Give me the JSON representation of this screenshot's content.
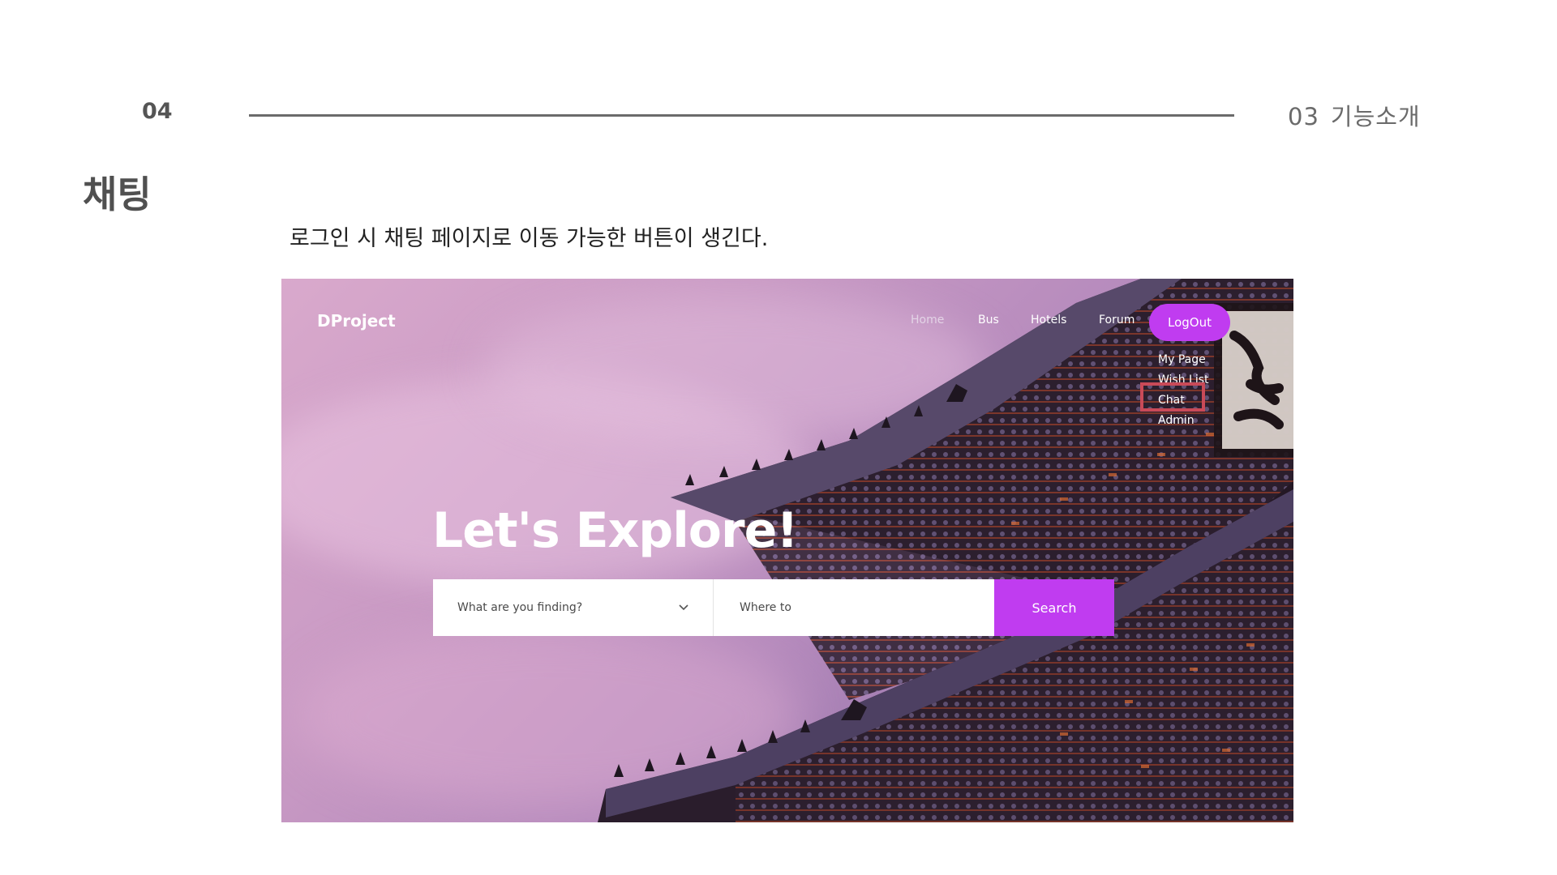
{
  "slide": {
    "page_number": "04",
    "section_number": "03",
    "section_title": "기능소개",
    "title": "채팅",
    "description": "로그인 시 채팅 페이지로 이동 가능한 버튼이 생긴다."
  },
  "site": {
    "brand": "DProject",
    "nav": {
      "home": "Home",
      "bus": "Bus",
      "hotels": "Hotels",
      "forum": "Forum",
      "logout": "LogOut"
    },
    "dropdown": [
      "My Page",
      "Wish List",
      "Chat",
      "Admin"
    ],
    "hero_title": "Let's Explore!",
    "search": {
      "select_placeholder": "What are you finding?",
      "where_placeholder": "Where to",
      "button": "Search"
    },
    "colors": {
      "accent": "#c03cf0",
      "highlight": "#c94a58"
    }
  }
}
